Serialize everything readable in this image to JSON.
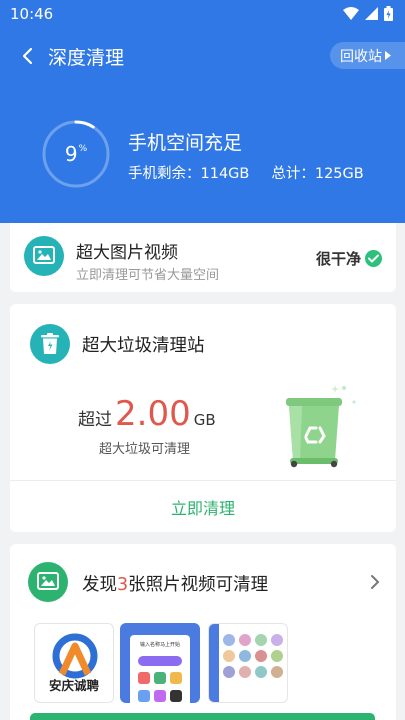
{
  "status_bar": {
    "time": "10:46"
  },
  "nav": {
    "title": "深度清理",
    "recycle_label": "回收站"
  },
  "storage": {
    "percent": "9",
    "percent_unit": "%",
    "percent_value": 0.09,
    "title": "手机空间充足",
    "remaining": "手机剩余：114GB",
    "total": "总计：125GB"
  },
  "big_media": {
    "title": "超大图片视频",
    "subtitle": "立即清理可节省大量空间",
    "status": "很干净"
  },
  "big_junk": {
    "title": "超大垃圾清理站",
    "prefix": "超过",
    "amount": "2.00",
    "unit": "GB",
    "description": "超大垃圾可清理",
    "action": "立即清理"
  },
  "photos": {
    "title_prefix": "发现",
    "count": "3",
    "title_suffix": "张照片视频可清理",
    "thumb1_label": "安庆诚聘",
    "thumb2_text": "输入名称马上开始"
  },
  "colors": {
    "header_blue": "#2f78e6",
    "accent_green": "#2cb36f",
    "teal": "#25b3b8",
    "highlight_red": "#e0584b"
  }
}
